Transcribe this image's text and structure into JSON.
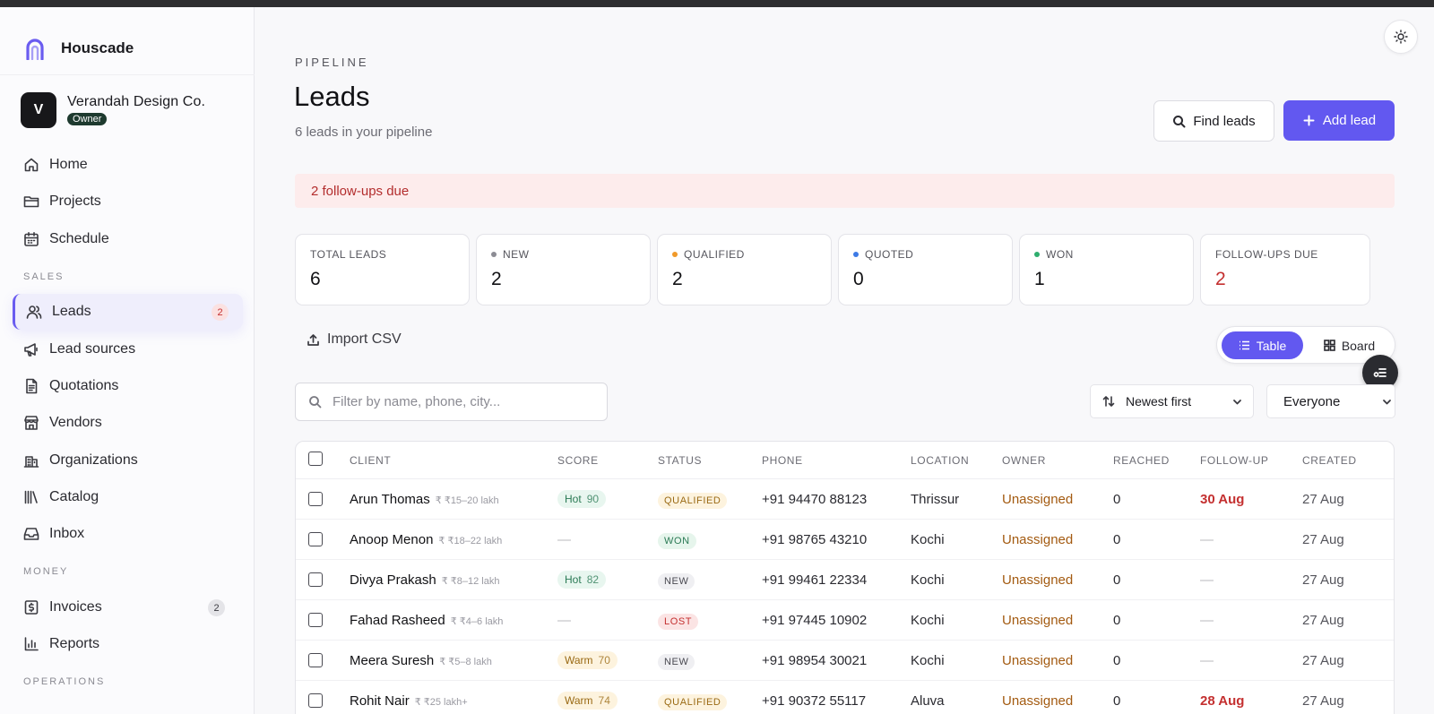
{
  "brand": {
    "name": "Houscade"
  },
  "org": {
    "initial": "V",
    "name": "Verandah Design Co.",
    "role": "Owner"
  },
  "nav": {
    "home": "Home",
    "projects": "Projects",
    "schedule": "Schedule",
    "sales_label": "SALES",
    "leads": "Leads",
    "leads_badge": "2",
    "lead_sources": "Lead sources",
    "quotations": "Quotations",
    "vendors": "Vendors",
    "organizations": "Organizations",
    "catalog": "Catalog",
    "inbox": "Inbox",
    "money_label": "MONEY",
    "invoices": "Invoices",
    "invoices_badge": "2",
    "reports": "Reports",
    "operations_label": "OPERATIONS"
  },
  "header": {
    "eyebrow": "PIPELINE",
    "title": "Leads",
    "subtitle": "6 leads in your pipeline",
    "find_label": "Find leads",
    "add_label": "Add lead"
  },
  "alert": "2 follow-ups due",
  "stats": [
    {
      "label": "TOTAL LEADS",
      "value": "6"
    },
    {
      "label": "NEW",
      "value": "2",
      "dot": "#8c8c94"
    },
    {
      "label": "QUALIFIED",
      "value": "2",
      "dot": "#f09a2a"
    },
    {
      "label": "QUOTED",
      "value": "0",
      "dot": "#3d7ae6"
    },
    {
      "label": "WON",
      "value": "1",
      "dot": "#2fae6e"
    },
    {
      "label": "FOLLOW-UPS DUE",
      "value": "2"
    }
  ],
  "toolbar": {
    "import_label": "Import CSV",
    "view_table": "Table",
    "view_board": "Board",
    "search_placeholder": "Filter by name, phone, city...",
    "sort_label": "Newest first",
    "owner_filter": "Everyone"
  },
  "table": {
    "columns": [
      "CLIENT",
      "SCORE",
      "STATUS",
      "PHONE",
      "LOCATION",
      "OWNER",
      "REACHED",
      "FOLLOW-UP",
      "CREATED"
    ],
    "rows": [
      {
        "client": "Arun Thomas",
        "budget": "₹ ₹15–20 lakh",
        "score_label": "Hot",
        "score_value": "90",
        "status": "QUALIFIED",
        "phone": "+91 94470 88123",
        "location": "Thrissur",
        "owner": "Unassigned",
        "reached": "0",
        "follow_up": "30 Aug",
        "created": "27 Aug"
      },
      {
        "client": "Anoop Menon",
        "budget": "₹ ₹18–22 lakh",
        "score_label": "",
        "score_value": "—",
        "status": "WON",
        "phone": "+91 98765 43210",
        "location": "Kochi",
        "owner": "Unassigned",
        "reached": "0",
        "follow_up": "—",
        "created": "27 Aug"
      },
      {
        "client": "Divya Prakash",
        "budget": "₹ ₹8–12 lakh",
        "score_label": "Hot",
        "score_value": "82",
        "status": "NEW",
        "phone": "+91 99461 22334",
        "location": "Kochi",
        "owner": "Unassigned",
        "reached": "0",
        "follow_up": "—",
        "created": "27 Aug"
      },
      {
        "client": "Fahad Rasheed",
        "budget": "₹ ₹4–6 lakh",
        "score_label": "",
        "score_value": "—",
        "status": "LOST",
        "phone": "+91 97445 10902",
        "location": "Kochi",
        "owner": "Unassigned",
        "reached": "0",
        "follow_up": "—",
        "created": "27 Aug"
      },
      {
        "client": "Meera Suresh",
        "budget": "₹ ₹5–8 lakh",
        "score_label": "Warm",
        "score_value": "70",
        "status": "NEW",
        "phone": "+91 98954 30021",
        "location": "Kochi",
        "owner": "Unassigned",
        "reached": "0",
        "follow_up": "—",
        "created": "27 Aug"
      },
      {
        "client": "Rohit Nair",
        "budget": "₹ ₹25 lakh+",
        "score_label": "Warm",
        "score_value": "74",
        "status": "QUALIFIED",
        "phone": "+91 90372 55117",
        "location": "Aluva",
        "owner": "Unassigned",
        "reached": "0",
        "follow_up": "28 Aug",
        "created": "27 Aug"
      }
    ]
  }
}
